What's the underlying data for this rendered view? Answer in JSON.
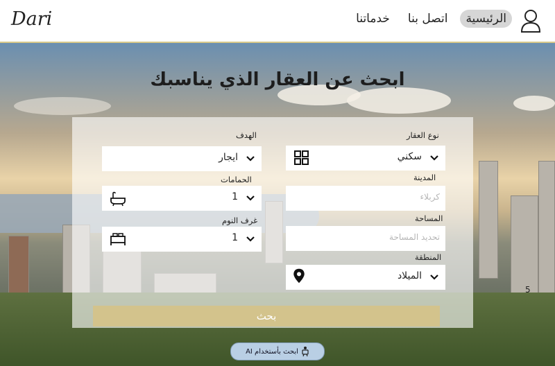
{
  "brand": {
    "logo": "Dari"
  },
  "nav": {
    "items": [
      {
        "label": "الرئيسية",
        "active": true
      },
      {
        "label": "اتصل بنا",
        "active": false
      },
      {
        "label": "خدماتنا",
        "active": false
      }
    ],
    "user_icon": "user-icon"
  },
  "hero": {
    "title": "ابحث عن العقار الذي يناسبك"
  },
  "form": {
    "property_type": {
      "label": "نوع العقار",
      "value": "سكني",
      "icon": "grid-icon"
    },
    "purpose": {
      "label": "الهدف",
      "value": "ايجار"
    },
    "city": {
      "label": "المدينة",
      "placeholder": "كربلاء"
    },
    "bathrooms": {
      "label": "الحمامات",
      "value": "1",
      "icon": "bathtub-icon"
    },
    "area": {
      "label": "المساحة",
      "placeholder": "تحديد المساحة"
    },
    "bedrooms": {
      "label": "غرف النوم",
      "value": "1",
      "icon": "bed-icon"
    },
    "region": {
      "label": "المنطقة",
      "value": "الميلاد",
      "icon": "location-pin-icon"
    }
  },
  "actions": {
    "search_label": "بحث",
    "ai_search_label": "ابحث بأستخدام AI"
  },
  "misc": {
    "stray_number": "5"
  },
  "colors": {
    "accent": "#d3c38c",
    "ai_button": "#b9cfe4",
    "nav_border": "#d9c98a"
  }
}
